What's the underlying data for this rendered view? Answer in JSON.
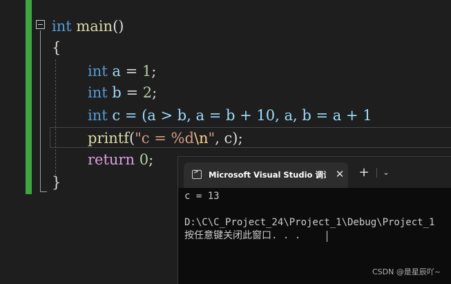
{
  "editor": {
    "lines": [
      {
        "keyword": "int",
        "fn": "main",
        "rest": "()"
      },
      {
        "text": "{"
      },
      {
        "keyword": "int",
        "var": "a",
        "eq": " = ",
        "num": "1",
        "end": ";"
      },
      {
        "keyword": "int",
        "var": "b",
        "eq": " = ",
        "num": "2",
        "end": ";"
      },
      {
        "keyword": "int",
        "var": "c",
        "expr": " = (a > b, a = b + 10, a, b = a + 1"
      },
      {
        "fn": "printf",
        "open": "(",
        "str1": "\"c = %d",
        "esc": "\\n",
        "str2": "\"",
        "rest": ", c);"
      },
      {
        "keyword": "return",
        "num": "0",
        "end": ";"
      },
      {
        "text": "}"
      }
    ]
  },
  "console": {
    "tab_title": "Microsoft Visual Studio 调试控制台",
    "close_glyph": "✕",
    "new_tab_glyph": "+",
    "dropdown_glyph": "⌄",
    "output": [
      "c = 13",
      "",
      "D:\\C\\C_Project_24\\Project_1\\Debug\\Project_1",
      "按任意键关闭此窗口. . ."
    ]
  },
  "watermark": "CSDN @是星辰吖~",
  "colors": {
    "keyword": "#569cd6",
    "function": "#dcdcaa",
    "variable": "#9cdcfe",
    "number": "#b5cea8",
    "string": "#d69d85",
    "return": "#d8a0df",
    "change_bar": "#3fa63f"
  }
}
